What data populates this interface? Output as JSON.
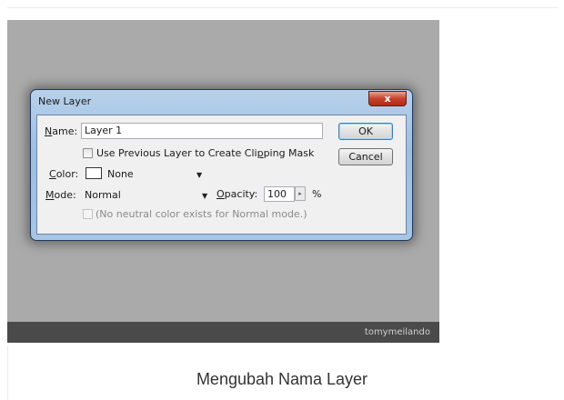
{
  "dialog": {
    "title": "New Layer",
    "close_glyph": "x",
    "name_label_first": "N",
    "name_label_rest": "ame:",
    "name_value": "Layer 1",
    "clipping_label_pre": "Use Previous Layer to Create Cli",
    "clipping_label_u": "p",
    "clipping_label_post": "ping Mask",
    "color_label_first": "C",
    "color_label_rest": "olor:",
    "color_value": "None",
    "mode_label_first": "M",
    "mode_label_rest": "ode:",
    "mode_value": "Normal",
    "opacity_label_first": "O",
    "opacity_label_rest": "pacity:",
    "opacity_value": "100",
    "opacity_unit": "%",
    "neutral_label": "(No neutral color exists for Normal mode.)",
    "ok_label": "OK",
    "cancel_label": "Cancel",
    "stepper_glyph": "▸",
    "caret_glyph": "▼"
  },
  "watermark": "tomymeilando",
  "caption": "Mengubah Nama Layer"
}
